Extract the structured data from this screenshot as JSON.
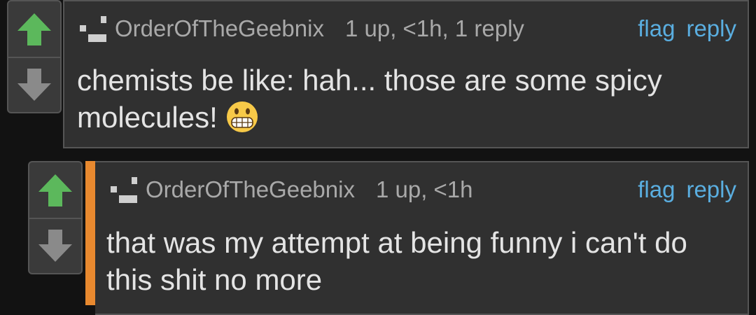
{
  "comments": [
    {
      "username": "OrderOfTheGeebnix",
      "stats": "1 up, <1h, 1 reply",
      "flag_label": "flag",
      "reply_label": "reply",
      "text": "chemists be like: hah... those are some spicy molecules!",
      "emoji": "grimacing-face"
    },
    {
      "username": "OrderOfTheGeebnix",
      "stats": "1 up, <1h",
      "flag_label": "flag",
      "reply_label": "reply",
      "text": "that was my attempt at being funny i can't do this shit no more"
    }
  ],
  "colors": {
    "upvote": "#5cb85c",
    "downvote": "#8a8a8a",
    "link": "#5aaee0",
    "reply_bar": "#e8892f"
  }
}
